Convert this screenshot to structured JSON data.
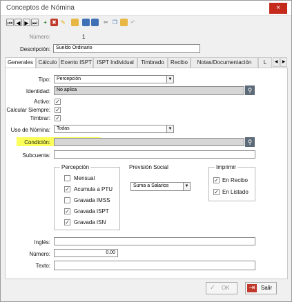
{
  "window": {
    "title": "Conceptos de Nómina",
    "close_icon": "×"
  },
  "header": {
    "numero_label": "Número:",
    "numero_value": "1",
    "descripcion_label": "Descripción:",
    "descripcion_value": "Sueldo Ordinario"
  },
  "tabs": [
    {
      "label": "Generales"
    },
    {
      "label": "Cálculo"
    },
    {
      "label": "Exento ISPT"
    },
    {
      "label": "ISPT Individual"
    },
    {
      "label": "Timbrado"
    },
    {
      "label": "Recibo"
    },
    {
      "label": "Notas/Documentación"
    },
    {
      "label": "L"
    }
  ],
  "form": {
    "tipo_label": "Tipo:",
    "tipo_value": "Percepción",
    "identidad_label": "Identidad:",
    "identidad_value": "No aplica",
    "activo_label": "Activo:",
    "calcular_label": "Calcular Siempre:",
    "timbrar_label": "Timbrar:",
    "uso_label": "Uso de Nómina:",
    "uso_value": "Todas",
    "condicion_label": "Condición:",
    "subcuenta_label": "Subcuenta:",
    "ingles_label": "Inglés:",
    "numero_label": "Número:",
    "numero_value": "0.00",
    "texto_label": "Texto:"
  },
  "percepcion": {
    "title": "Percepción",
    "items": [
      {
        "label": "Mensual",
        "checked": false
      },
      {
        "label": "Acumula a PTU",
        "checked": true
      },
      {
        "label": "Gravada IMSS",
        "checked": false
      },
      {
        "label": "Gravada ISPT",
        "checked": true
      },
      {
        "label": "Gravada ISN",
        "checked": true
      }
    ]
  },
  "prevision": {
    "title": "Previsión Social",
    "value": "Suma a Salarios"
  },
  "imprimir": {
    "title": "Imprimir",
    "items": [
      {
        "label": "En Recibo",
        "checked": true
      },
      {
        "label": "En Listado",
        "checked": true
      }
    ]
  },
  "footer": {
    "ok_label": "OK",
    "salir_label": "Salir"
  },
  "colors": {
    "highlight": "#fbff5a",
    "close_red": "#c42b1c",
    "salir_red": "#c0392b",
    "search_button": "#5d6b78"
  }
}
